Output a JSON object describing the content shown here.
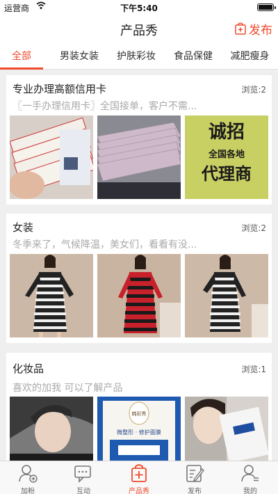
{
  "status_bar": {
    "carrier": "运营商",
    "time": "下午5:40"
  },
  "navbar": {
    "title": "产品秀",
    "publish_label": "发布"
  },
  "tabs": [
    {
      "label": "全部",
      "active": true
    },
    {
      "label": "男装女装",
      "active": false
    },
    {
      "label": "护肤彩妆",
      "active": false
    },
    {
      "label": "食品保健",
      "active": false
    },
    {
      "label": "减肥瘦身",
      "active": false
    }
  ],
  "posts": [
    {
      "title": "专业办理高额信用卡",
      "views": "浏览:2",
      "description": "〖一手办理信用卡〗全国接单，客户不需...",
      "images": [
        "credit-card-stack-photo",
        "cash-bundle-photo",
        "agent-recruit-poster"
      ],
      "poster_text": {
        "line1": "诚招",
        "line2": "全国各地",
        "line3": "代理商"
      }
    },
    {
      "title": "女装",
      "views": "浏览:2",
      "description": "冬季来了，气候降温，美女们，看看有没...",
      "images": [
        "striped-dress-black-photo",
        "striped-dress-red-photo",
        "striped-dress-black-side-photo"
      ]
    },
    {
      "title": "化妆品",
      "views": "浏览:1",
      "description": "喜欢的加我 可以了解产品",
      "images": [
        "model-portrait-photo",
        "face-mask-product-photo",
        "selfie-with-mask-photo"
      ],
      "product_text": {
        "brand": "韩彩秀",
        "tag": "微整形 · 修护面膜"
      }
    }
  ],
  "tabbar": [
    {
      "label": "加粉",
      "icon": "add-user-icon",
      "active": false
    },
    {
      "label": "互动",
      "icon": "chat-icon",
      "active": false
    },
    {
      "label": "产品秀",
      "icon": "bag-plus-icon",
      "active": true
    },
    {
      "label": "发布",
      "icon": "edit-icon",
      "active": false
    },
    {
      "label": "我的",
      "icon": "user-icon",
      "active": false
    }
  ],
  "colors": {
    "accent": "#f04a2c",
    "background": "#efefef"
  }
}
